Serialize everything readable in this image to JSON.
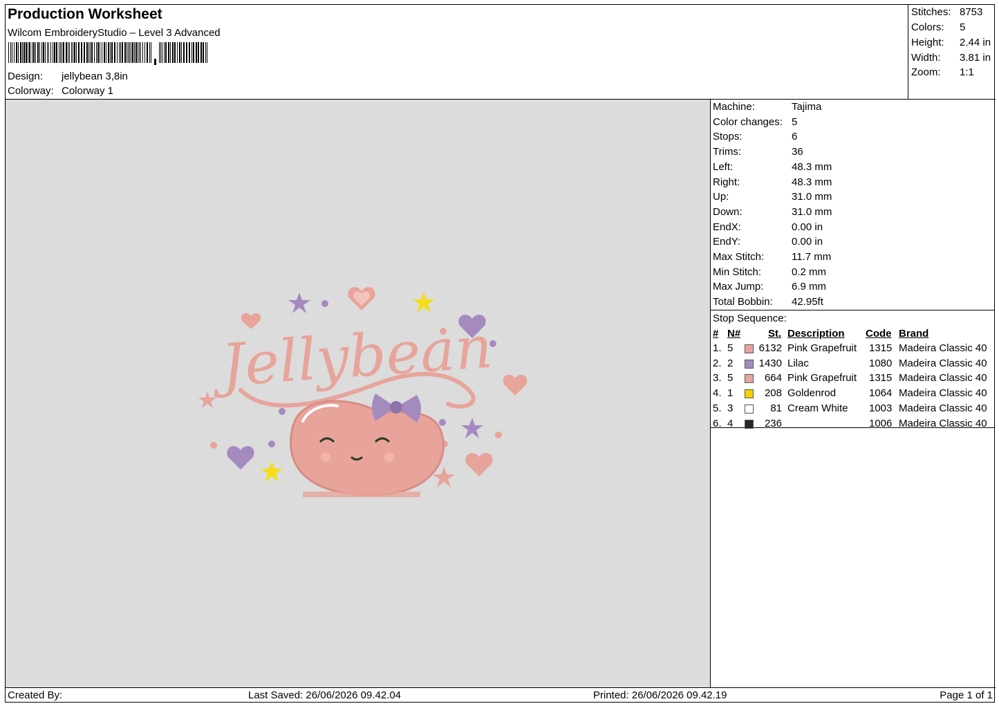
{
  "header": {
    "title": "Production Worksheet",
    "software": "Wilcom EmbroideryStudio – Level 3 Advanced",
    "design_label": "Design:",
    "design_value": "jellybean 3,8in",
    "colorway_label": "Colorway:",
    "colorway_value": "Colorway 1"
  },
  "stats": {
    "stitches_label": "Stitches:",
    "stitches": "8753",
    "colors_label": "Colors:",
    "colors": "5",
    "height_label": "Height:",
    "height": "2.44 in",
    "width_label": "Width:",
    "width": "3.81 in",
    "zoom_label": "Zoom:",
    "zoom": "1:1"
  },
  "machine_info": [
    {
      "label": "Machine:",
      "value": "Tajima"
    },
    {
      "label": "Color changes:",
      "value": "5"
    },
    {
      "label": "Stops:",
      "value": "6"
    },
    {
      "label": "Trims:",
      "value": "36"
    },
    {
      "label": "Left:",
      "value": "48.3 mm"
    },
    {
      "label": "Right:",
      "value": "48.3 mm"
    },
    {
      "label": "Up:",
      "value": "31.0 mm"
    },
    {
      "label": "Down:",
      "value": "31.0 mm"
    },
    {
      "label": "EndX:",
      "value": "0.00 in"
    },
    {
      "label": "EndY:",
      "value": "0.00 in"
    },
    {
      "label": "Max Stitch:",
      "value": "11.7 mm"
    },
    {
      "label": "Min Stitch:",
      "value": "0.2 mm"
    },
    {
      "label": "Max Jump:",
      "value": "6.9 mm"
    },
    {
      "label": "Total Bobbin:",
      "value": "42.95ft"
    }
  ],
  "stop_sequence": {
    "title": "Stop Sequence:",
    "headers": {
      "num": "#",
      "needle": "N#",
      "stitches": "St.",
      "description": "Description",
      "code": "Code",
      "brand": "Brand"
    },
    "rows": [
      {
        "num": "1.",
        "needle": "5",
        "color": "#e8a4a0",
        "stitches": "6132",
        "description": "Pink Grapefruit",
        "code": "1315",
        "brand": "Madeira Classic 40"
      },
      {
        "num": "2.",
        "needle": "2",
        "color": "#a58ac0",
        "stitches": "1430",
        "description": "Lilac",
        "code": "1080",
        "brand": "Madeira Classic 40"
      },
      {
        "num": "3.",
        "needle": "5",
        "color": "#e8a4a0",
        "stitches": "664",
        "description": "Pink Grapefruit",
        "code": "1315",
        "brand": "Madeira Classic 40"
      },
      {
        "num": "4.",
        "needle": "1",
        "color": "#f5d000",
        "stitches": "208",
        "description": "Goldenrod",
        "code": "1064",
        "brand": "Madeira Classic 40"
      },
      {
        "num": "5.",
        "needle": "3",
        "color": "#ffffff",
        "stitches": "81",
        "description": "Cream White",
        "code": "1003",
        "brand": "Madeira Classic 40"
      },
      {
        "num": "6.",
        "needle": "4",
        "color": "#1f2a22",
        "stitches": "236",
        "description": "",
        "code": "1006",
        "brand": "Madeira Classic 40"
      }
    ]
  },
  "design_preview": {
    "text": "Jellybean",
    "colors": {
      "pink": "#e8a49a",
      "lilac": "#a58ac0",
      "yellow": "#f5dd1a",
      "dark": "#2f3a2a",
      "canvas": "#dcdcdc"
    }
  },
  "footer": {
    "created_by": "Created By:",
    "last_saved": "Last Saved: 26/06/2026 09.42.04",
    "printed": "Printed: 26/06/2026 09.42.19",
    "page": "Page 1 of 1"
  }
}
